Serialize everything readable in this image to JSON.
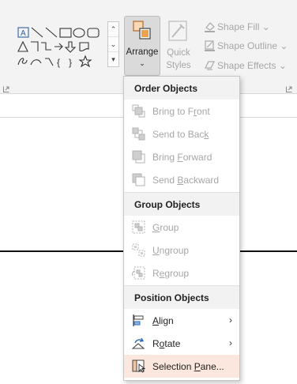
{
  "ribbon": {
    "arrange": {
      "label": "Arrange",
      "caret": "⌄"
    },
    "quick_styles": {
      "line1": "Quick",
      "line2": "Styles ⌄"
    },
    "shape_fill": "Shape Fill ⌄",
    "shape_outline": "Shape Outline ⌄",
    "shape_effects": "Shape Effects ⌄"
  },
  "menu": {
    "order_header": "Order Objects",
    "order_items": [
      {
        "pre": "Bring to F",
        "key": "r",
        "post": "ont",
        "icon": "bring-to-front-icon",
        "enabled": false
      },
      {
        "pre": "Send to Bac",
        "key": "k",
        "post": "",
        "icon": "send-to-back-icon",
        "enabled": false
      },
      {
        "pre": "Bring ",
        "key": "F",
        "post": "orward",
        "icon": "bring-forward-icon",
        "enabled": false
      },
      {
        "pre": "Send ",
        "key": "B",
        "post": "ackward",
        "icon": "send-backward-icon",
        "enabled": false
      }
    ],
    "group_header": "Group Objects",
    "group_items": [
      {
        "pre": "",
        "key": "G",
        "post": "roup",
        "icon": "group-icon",
        "enabled": false
      },
      {
        "pre": "",
        "key": "U",
        "post": "ngroup",
        "icon": "ungroup-icon",
        "enabled": false
      },
      {
        "pre": "R",
        "key": "e",
        "post": "group",
        "icon": "regroup-icon",
        "enabled": false
      }
    ],
    "position_header": "Position Objects",
    "position_items": [
      {
        "pre": "",
        "key": "A",
        "post": "lign",
        "icon": "align-icon",
        "enabled": true,
        "submenu": true
      },
      {
        "pre": "R",
        "key": "o",
        "post": "tate",
        "icon": "rotate-icon",
        "enabled": true,
        "submenu": true
      },
      {
        "pre": "Selection ",
        "key": "P",
        "post": "ane...",
        "icon": "selection-pane-icon",
        "enabled": true,
        "submenu": false,
        "highlighted": true
      }
    ],
    "submenu_arrow": "›"
  },
  "colors": {
    "accent": "#c43e1c",
    "highlight": "#fbe7dd",
    "disabled_text": "#a6a6a6"
  }
}
